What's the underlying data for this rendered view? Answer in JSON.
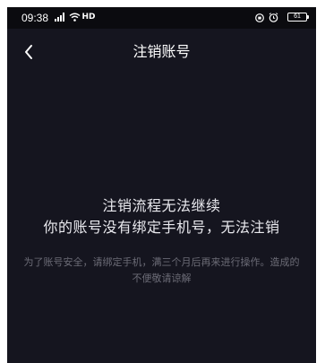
{
  "status_bar": {
    "time": "09:38",
    "hd_label": "HD",
    "battery_level": "61"
  },
  "nav": {
    "title": "注销账号"
  },
  "message": {
    "line1": "注销流程无法继续",
    "line2": "你的账号没有绑定手机号，无法注销",
    "detail": "为了账号安全，请绑定手机，满三个月后再来进行操作。造成的不便敬请谅解"
  },
  "colors": {
    "background": "#15151f",
    "status_bar": "#0b0b0f",
    "primary_text": "#ffffff",
    "secondary_text": "#6b6b76"
  },
  "icons": {
    "back": "chevron-left-icon",
    "signal": "signal-icon",
    "wifi": "wifi-icon",
    "hd": "hd-icon",
    "lock": "lock-icon",
    "alarm": "alarm-icon",
    "battery": "battery-icon"
  }
}
